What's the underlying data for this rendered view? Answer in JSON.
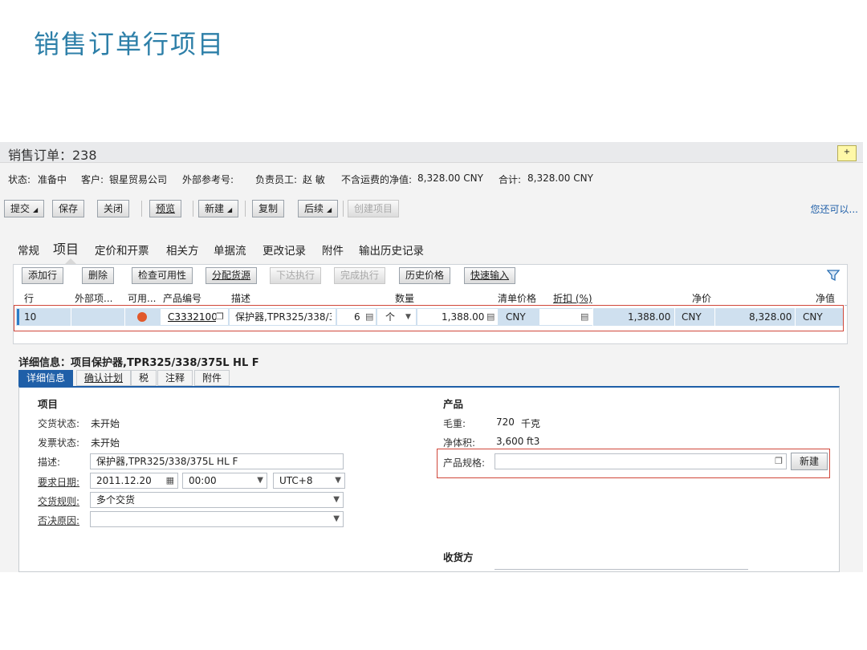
{
  "slide_title": "销售订单行项目",
  "header": {
    "title": "销售订单：238"
  },
  "info": {
    "status_label": "状态:",
    "status_value": "准备中",
    "customer_label": "客户:",
    "customer_value": "银星贸易公司",
    "ext_ref_label": "外部参考号:",
    "owner_label": "负责员工:",
    "owner_value": "赵 敏",
    "net_label": "不含运费的净值:",
    "net_value": "8,328.00  CNY",
    "total_label": "合计:",
    "total_value": "8,328.00  CNY"
  },
  "toolbar": {
    "submit": "提交",
    "save": "保存",
    "close": "关闭",
    "preview": "预览",
    "new": "新建",
    "copy": "复制",
    "followup": "后续",
    "create_item": "创建项目",
    "also": "您还可以..."
  },
  "tabs": [
    "常规",
    "项目",
    "定价和开票",
    "相关方",
    "单据流",
    "更改记录",
    "附件",
    "输出历史记录"
  ],
  "grid_toolbar": {
    "add_row": "添加行",
    "delete": "删除",
    "check": "检查可用性",
    "allocate": "分配货源",
    "release": "下达执行",
    "finish": "完成执行",
    "price_history": "历史价格",
    "quick_entry": "快速输入"
  },
  "grid_headers": [
    "行",
    "外部项...",
    "可用...",
    "产品编号",
    "描述",
    "数量",
    "清单价格",
    "折扣 (%)",
    "净价",
    "净值"
  ],
  "grid_row": {
    "line": "10",
    "product": "C3332100",
    "description": "保护器,TPR325/338/3",
    "qty": "6",
    "unit": "个",
    "list_price": "1,388.00",
    "list_currency": "CNY",
    "net_price": "1,388.00",
    "net_price_currency": "CNY",
    "net_value": "8,328.00",
    "net_value_currency": "CNY"
  },
  "details": {
    "title": "详细信息：项目保护器,TPR325/338/375L HL F",
    "tabs": [
      "详细信息",
      "确认计划",
      "税",
      "注释",
      "附件"
    ],
    "item_section": "项目",
    "delivery_status_label": "交货状态:",
    "delivery_status_value": "未开始",
    "invoice_status_label": "发票状态:",
    "invoice_status_value": "未开始",
    "desc_label": "描述:",
    "desc_value": "保护器,TPR325/338/375L HL F",
    "req_date_label": "要求日期:",
    "req_date_value": "2011.12.20",
    "req_time_value": "00:00",
    "timezone_value": "UTC+8",
    "delivery_rule_label": "交货规则:",
    "delivery_rule_value": "多个交货",
    "reject_label": "否决原因:",
    "product_section": "产品",
    "gross_label": "毛重:",
    "gross_value": "720",
    "gross_unit": "千克",
    "volume_label": "净体积:",
    "volume_value": "3,600",
    "volume_unit": "ft3",
    "spec_label": "产品规格:",
    "spec_new": "新建",
    "ship_to_section": "收货方"
  },
  "colors": {
    "accent": "#1f5fa8",
    "title": "#2d7fa8",
    "highlight": "#d0473a",
    "row": "#cfe0ef",
    "status": "#e1582a"
  }
}
